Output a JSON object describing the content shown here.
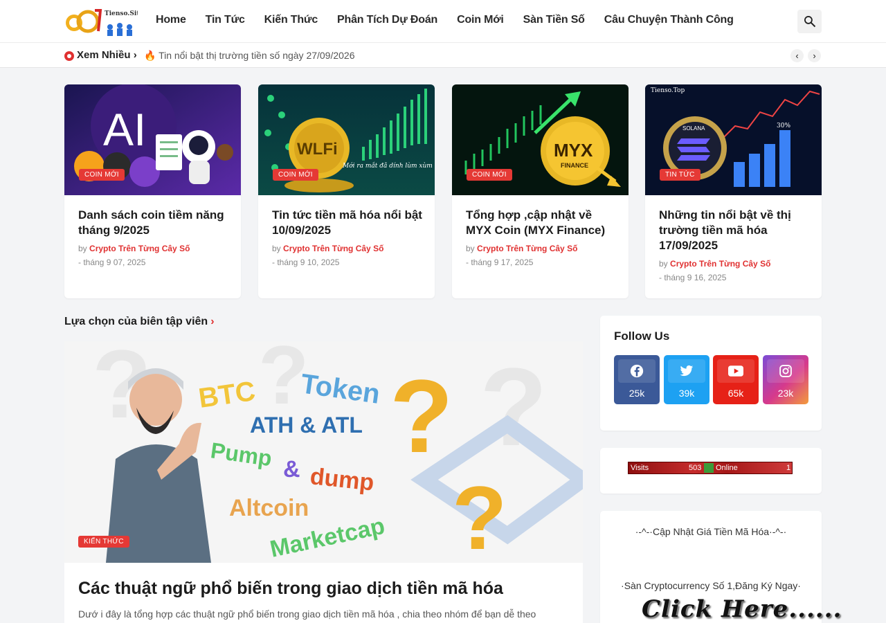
{
  "header": {
    "logo_text": "Tienso.Site",
    "nav": [
      "Home",
      "Tin Tức",
      "Kiến Thức",
      "Phân Tích Dự Đoán",
      "Coin Mới",
      "Sàn Tiền Số",
      "Câu Chuyện Thành Công"
    ]
  },
  "ticker": {
    "title": "Xem Nhiều",
    "headline": "🔥 Tin nổi bật thị trường tiền số ngày 27/09/2026"
  },
  "cards": [
    {
      "badge": "COIN MỚI",
      "title": "Danh sách coin tiềm năng tháng 9/2025",
      "by": "by",
      "author": "Crypto Trên Từng Cây Số",
      "date": "- tháng 9 07, 2025",
      "image_text": "AI"
    },
    {
      "badge": "COIN MỚI",
      "title": "Tin tức tiền mã hóa nổi bật 10/09/2025",
      "by": "by",
      "author": "Crypto Trên Từng Cây Số",
      "date": "- tháng 9 10, 2025",
      "image_text": "WLFi",
      "image_caption": "Mới ra mắt đã dính lùm xùm !?"
    },
    {
      "badge": "COIN MỚI",
      "title": "Tổng hợp ,cập nhật về MYX Coin (MYX Finance)",
      "by": "by",
      "author": "Crypto Trên Từng Cây Số",
      "date": "- tháng 9 17, 2025",
      "image_text": "MYX",
      "image_subtext": "FINANCE"
    },
    {
      "badge": "TIN TỨC",
      "title": "Những tin nổi bật về thị trường tiền mã hóa 17/09/2025",
      "by": "by",
      "author": "Crypto Trên Từng Cây Số",
      "date": "- tháng 9 16, 2025",
      "image_text": "Tienso.Top",
      "image_subtext": "SOLANA",
      "image_pct": "30%"
    }
  ],
  "editor": {
    "section_title": "Lựa chọn của biên tập viên",
    "badge": "KIẾN THỨC",
    "title": "Các thuật ngữ phổ biến trong giao dịch tiền mã hóa",
    "excerpt": "Dướ i đây là   tổng hợp các thuật ngữ phổ biến trong giao dịch tiền mã hóa , chia theo nhóm để bạn dễ theo",
    "image_words": [
      "BTC",
      "Token",
      "ATH & ATL",
      "Pump",
      "&",
      "dump",
      "Altcoin",
      "Marketcap"
    ]
  },
  "follow": {
    "title": "Follow Us",
    "items": [
      {
        "name": "facebook",
        "count": "25k",
        "color": "#3b5998"
      },
      {
        "name": "twitter",
        "count": "39k",
        "color": "#1da1f2"
      },
      {
        "name": "youtube",
        "count": "65k",
        "color": "#e62117"
      },
      {
        "name": "instagram",
        "count": "23k",
        "color": "#c13584"
      }
    ]
  },
  "counter": {
    "visits_label": "Visits",
    "visits": "503",
    "online_label": "Online",
    "online": "1"
  },
  "price_widget": {
    "title": "·-^-·Cập Nhật Giá Tiền Mã Hóa·-^-·",
    "register": "·Sàn Cryptocurrency Số 1,Đăng Ký Ngay·",
    "click": "Click Here......"
  }
}
